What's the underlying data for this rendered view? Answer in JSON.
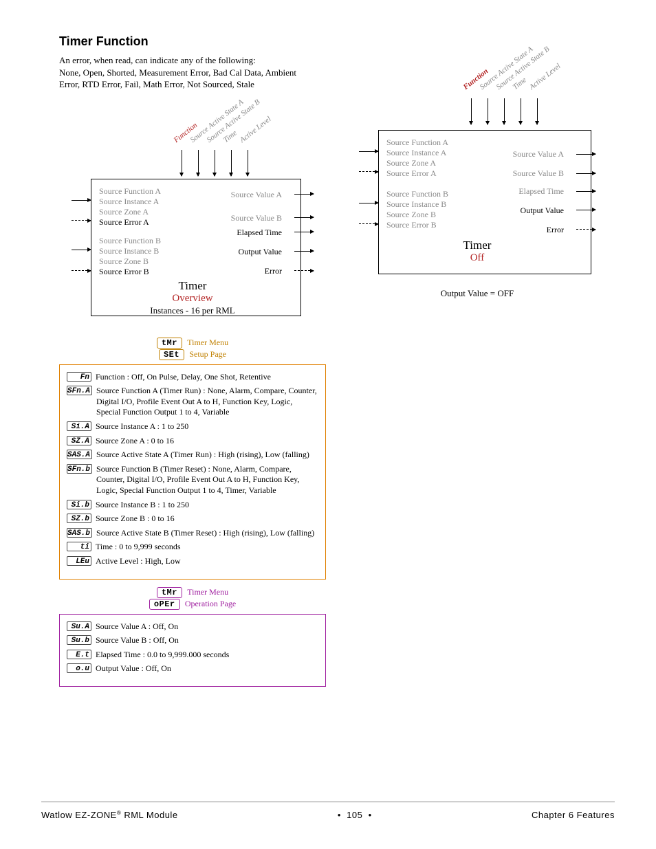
{
  "title": "Timer Function",
  "intro_line1": "An error, when read, can indicate any of the following:",
  "intro_line2": "None, Open, Shorted, Measurement Error, Bad Cal Data, Ambient Error, RTD Error, Fail, Math Error, Not Sourced, Stale",
  "overview": {
    "top_labels": [
      "Function",
      "Source Active State A",
      "Source Active State B",
      "Time",
      "Active Level"
    ],
    "left_a": [
      "Source Function A",
      "Source Instance A",
      "Source Zone A",
      "Source Error A"
    ],
    "left_b": [
      "Source Function B",
      "Source Instance B",
      "Source Zone B",
      "Source Error B"
    ],
    "right": [
      "Source Value A",
      "Source Value B",
      "Elapsed Time",
      "Output Value",
      "Error"
    ],
    "timer": "Timer",
    "subtitle": "Overview",
    "instances": "Instances - 16 per RML"
  },
  "off_diagram": {
    "top_labels": [
      "Function",
      "Source Active State A",
      "Source Active State B",
      "Time",
      "Active Level"
    ],
    "left_a": [
      "Source Function A",
      "Source Instance A",
      "Source Zone A",
      "Source Error A"
    ],
    "left_b": [
      "Source Function B",
      "Source Instance B",
      "Source Zone B",
      "Source Error B"
    ],
    "right": [
      "Source Value A",
      "Source Value B",
      "Elapsed Time",
      "Output Value",
      "Error"
    ],
    "timer": "Timer",
    "subtitle": "Off",
    "caption": "Output Value = OFF"
  },
  "setup": {
    "menu_code": "tMr",
    "menu_label": "Timer Menu",
    "page_code": "SEt",
    "page_label": "Setup Page",
    "params": [
      {
        "code": "Fn",
        "text": "Function : Off, On Pulse, Delay, One Shot, Retentive"
      },
      {
        "code": "SFn.A",
        "text": "Source Function A (Timer Run) : None, Alarm, Compare, Counter, Digital I/O, Profile Event Out A to H, Function Key, Logic, Special Function Output 1 to 4, Variable"
      },
      {
        "code": "Si.A",
        "text": "Source Instance A : 1 to 250"
      },
      {
        "code": "SZ.A",
        "text": "Source Zone A : 0 to 16"
      },
      {
        "code": "SAS.A",
        "text": "Source Active State A (Timer Run) : High (rising), Low (falling)"
      },
      {
        "code": "SFn.b",
        "text": "Source Function B (Timer Reset) : None, Alarm, Compare, Counter, Digital I/O, Profile Event Out A to H, Function Key, Logic, Special Function Output 1 to 4, Timer, Variable"
      },
      {
        "code": "Si.b",
        "text": "Source Instance B : 1 to 250"
      },
      {
        "code": "SZ.b",
        "text": "Source Zone B : 0 to 16"
      },
      {
        "code": "SAS.b",
        "text": "Source Active State B (Timer Reset) : High (rising), Low (falling)"
      },
      {
        "code": "ti",
        "text": "Time : 0 to 9,999 seconds"
      },
      {
        "code": "LEu",
        "text": "Active Level : High, Low"
      }
    ]
  },
  "operation": {
    "menu_code": "tMr",
    "menu_label": "Timer Menu",
    "page_code": "oPEr",
    "page_label": "Operation Page",
    "params": [
      {
        "code": "Su.A",
        "text": "Source Value A : Off, On"
      },
      {
        "code": "Su.b",
        "text": "Source Value B : Off, On"
      },
      {
        "code": "E.t",
        "text": "Elapsed Time : 0.0 to 9,999.000 seconds"
      },
      {
        "code": "o.u",
        "text": "Output Value : Off, On"
      }
    ]
  },
  "footer": {
    "left": "Watlow EZ-ZONE",
    "left_sup": "®",
    "left2": " RML Module",
    "page": "105",
    "right": "Chapter 6 Features"
  }
}
